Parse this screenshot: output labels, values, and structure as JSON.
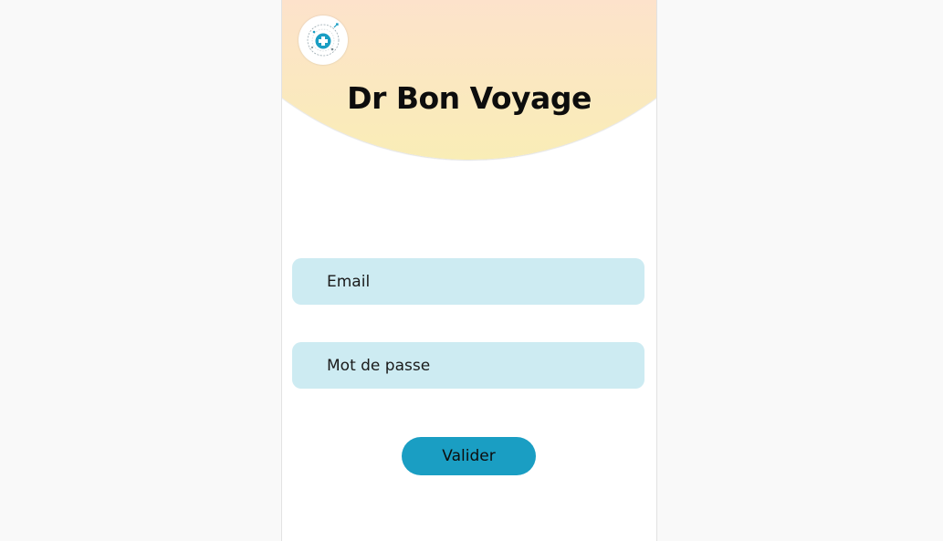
{
  "app": {
    "title": "Dr Bon Voyage",
    "logo_icon": "medical-cross-globe-icon"
  },
  "form": {
    "email_placeholder": "Email",
    "password_placeholder": "Mot de passe",
    "submit_label": "Valider"
  },
  "colors": {
    "header_top": "#fde2cc",
    "header_bottom": "#f9edb6",
    "field_bg": "#cdebf2",
    "button_bg": "#1a9ec3",
    "logo_accent": "#1a9ec3"
  }
}
